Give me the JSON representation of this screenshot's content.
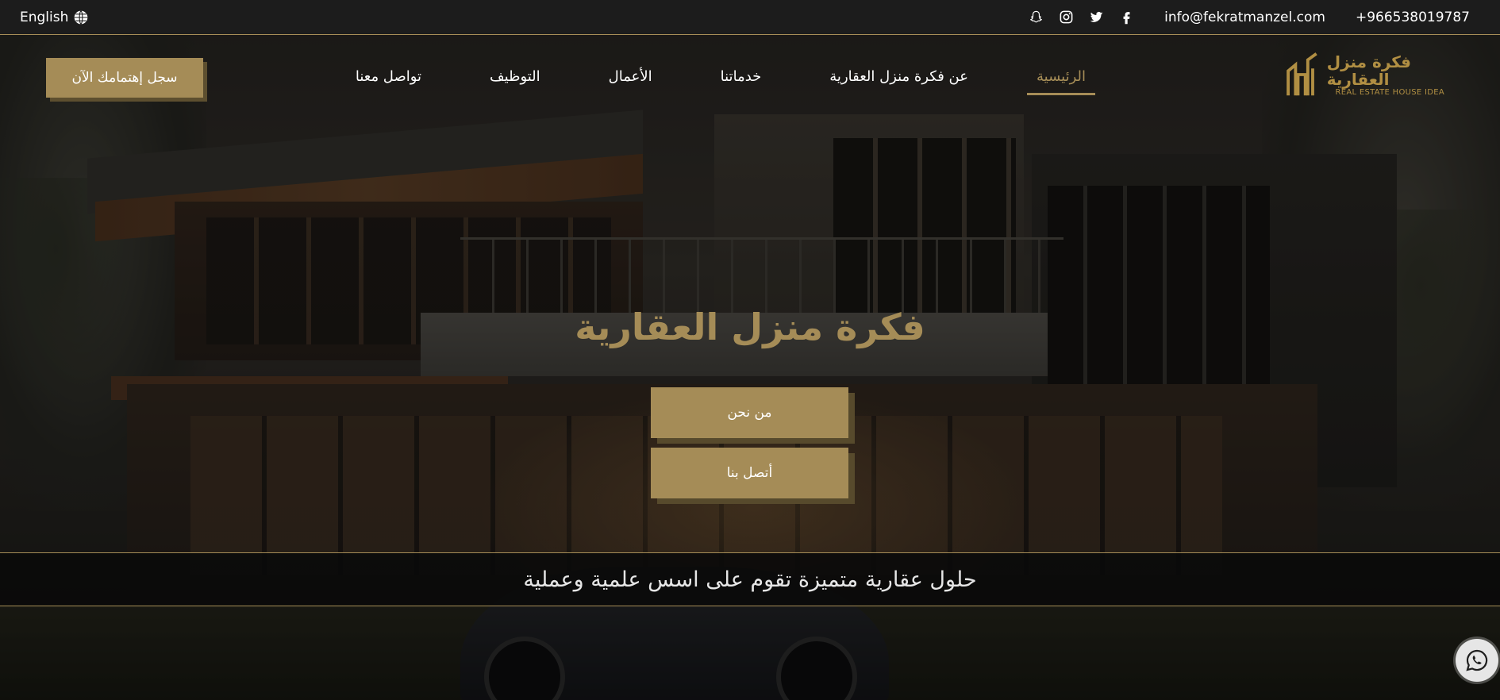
{
  "topbar": {
    "language_label": "English",
    "email": "info@fekratmanzel.com",
    "phone": "+966538019787",
    "social_icons": [
      "snapchat-icon",
      "instagram-icon",
      "twitter-icon",
      "facebook-icon"
    ],
    "globe_icon": "globe-icon"
  },
  "nav": {
    "cta_label": "سجل إهتمامك الآن",
    "items": [
      {
        "label": "الرئيسية",
        "active": true
      },
      {
        "label": "عن فكرة منزل العقارية",
        "active": false
      },
      {
        "label": "خدماتنا",
        "active": false
      },
      {
        "label": "الأعمال",
        "active": false
      },
      {
        "label": "التوظيف",
        "active": false
      },
      {
        "label": "تواصل معنا",
        "active": false
      }
    ]
  },
  "logo": {
    "arabic_name": "فكرة منزل العقارية",
    "english_name": "REAL ESTATE HOUSE IDEA"
  },
  "hero": {
    "title": "فكرة منزل العقارية",
    "about_button": "من نحن",
    "contact_button": "أتصل بنا",
    "tagline": "حلول عقارية متميزة تقوم على اسس علمية وعملية"
  },
  "floating": {
    "whatsapp_icon": "whatsapp-icon"
  },
  "colors": {
    "accent_gold": "#a58c57",
    "topbar_bg": "#1c1c1c",
    "text_white": "#ffffff"
  }
}
